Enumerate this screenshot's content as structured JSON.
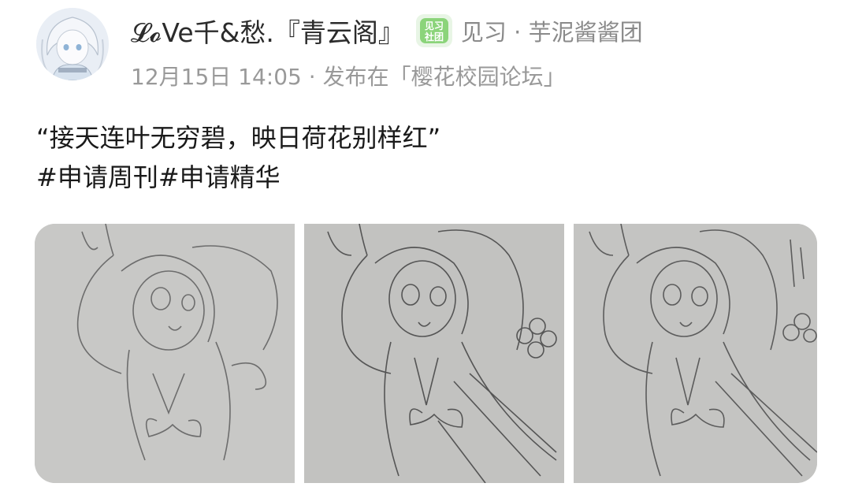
{
  "post": {
    "author": "𝓛𝓸Ve千&愁.『青云阁』",
    "badge_text": "见习\n社团",
    "group": "见习 · 芋泥酱酱团",
    "date": "12月15日 14:05",
    "separator": " · ",
    "published_in": "发布在「樱花校园论坛」",
    "text": "“接天连叶无穷碧，映日荷花别样红”",
    "tags": [
      "#申请周刊",
      "#申请精华"
    ]
  },
  "photos": [
    {
      "name": "pencil-sketch-photo-1"
    },
    {
      "name": "pencil-sketch-photo-2"
    },
    {
      "name": "pencil-sketch-photo-3"
    }
  ],
  "colors": {
    "badge_green": "#4caf50",
    "meta_gray": "#999999",
    "paper": "#c7c7c5"
  }
}
